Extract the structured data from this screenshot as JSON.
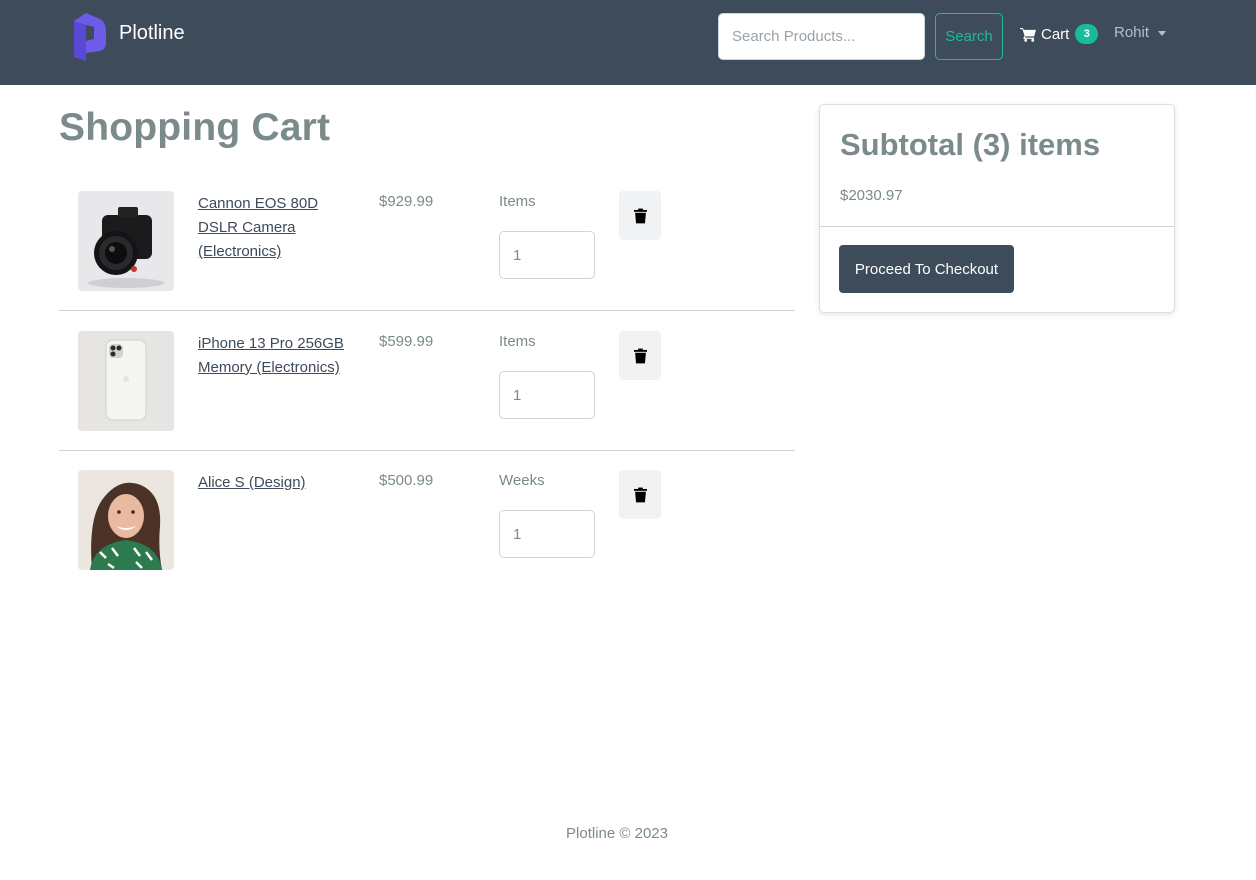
{
  "navbar": {
    "brand_name": "Plotline",
    "search_placeholder": "Search Products...",
    "search_label": "Search",
    "cart_label": "Cart",
    "cart_count": "3",
    "user_name": "Rohit"
  },
  "page_title": "Shopping Cart",
  "cart_items": [
    {
      "name": "Cannon EOS 80D DSLR Camera (Electronics)",
      "price": "$929.99",
      "qty_label": "Items",
      "qty": "1",
      "image": "camera-photo"
    },
    {
      "name": "iPhone 13 Pro 256GB Memory (Electronics)",
      "price": "$599.99",
      "qty_label": "Items",
      "qty": "1",
      "image": "phone-photo"
    },
    {
      "name": "Alice S (Design)",
      "price": "$500.99",
      "qty_label": "Weeks",
      "qty": "1",
      "image": "person-photo"
    }
  ],
  "summary": {
    "title": "Subtotal (3) items",
    "amount": "$2030.97",
    "checkout_label": "Proceed To Checkout"
  },
  "footer": {
    "text": "Plotline © 2023"
  },
  "colors": {
    "navbar_bg": "#3e4b5b",
    "accent": "#18bc9c",
    "brand_logo": "#6c5ce7",
    "text_muted": "#7b8a8b"
  }
}
